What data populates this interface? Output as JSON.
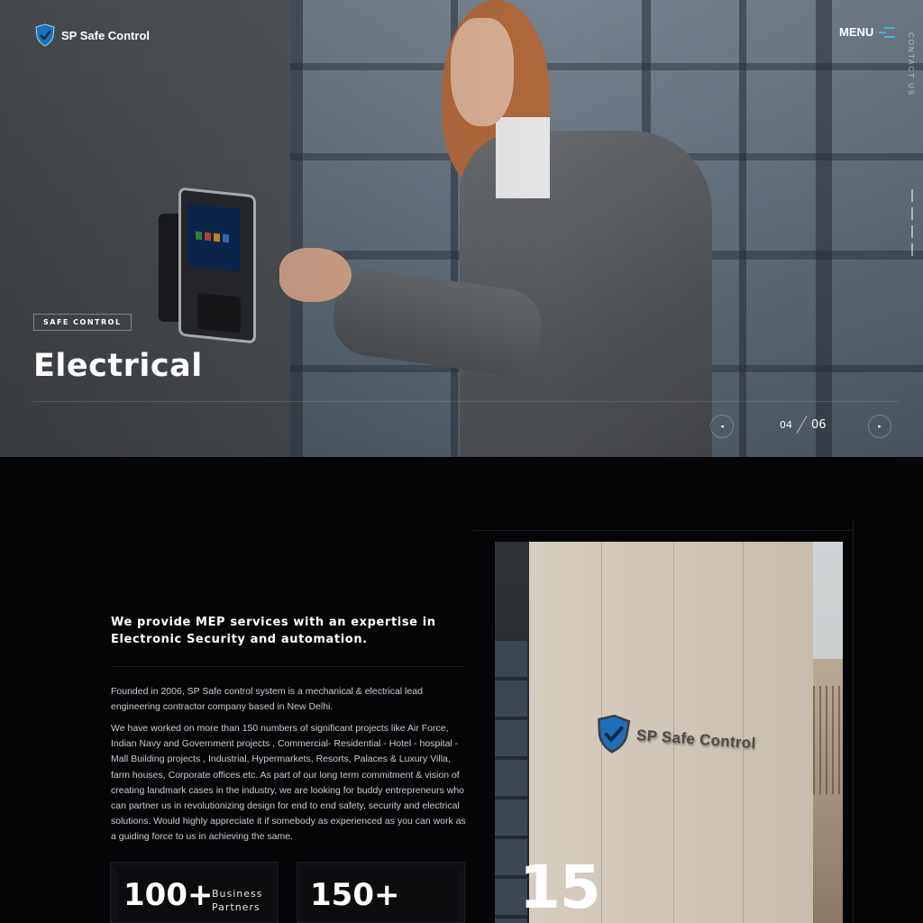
{
  "header": {
    "logo_text": "SP Safe Control",
    "menu_label": "MENU",
    "side_label": "CONTACT US"
  },
  "hero": {
    "tag": "SAFE CONTROL",
    "title": "Electrical",
    "slide_current": "04",
    "slide_total": "06",
    "prev_icon": "◂",
    "next_icon": "▸"
  },
  "about": {
    "heading": "We provide MEP services with an expertise in Electronic Security and automation.",
    "paragraph_1": "Founded in 2006, SP Safe control system is a mechanical & electrical lead engineering contractor company based in New Delhi.",
    "paragraph_2": "We have worked on more than 150 numbers of significant projects like Air Force, Indian Navy and Government projects , Commercial- Residential - Hotel - hospital - Mall Building projects , Industrial, Hypermarkets, Resorts, Palaces & Luxury Villa, farm houses, Corporate offices etc. As part of our long term commitment & vision of creating landmark cases in the industry, we are looking for buddy entrepreneurs who can partner us in revolutionizing design for end to end safety, security and electrical solutions. Would highly appreciate it if somebody as experienced as you can work as a guiding force to us in achieving the same.",
    "stats": [
      {
        "value": "100+",
        "label": "Business Partners"
      },
      {
        "value": "150+",
        "label": ""
      }
    ],
    "image_sign_text": "SP Safe Control",
    "years_value": "15"
  },
  "colors": {
    "accent": "#3fb5e8",
    "background": "#050507",
    "shield_blue": "#1e6fb8"
  },
  "icons": {
    "logo": "shield-logo-icon",
    "menu": "hamburger-icon",
    "prev": "arrow-left-icon",
    "next": "arrow-right-icon"
  }
}
